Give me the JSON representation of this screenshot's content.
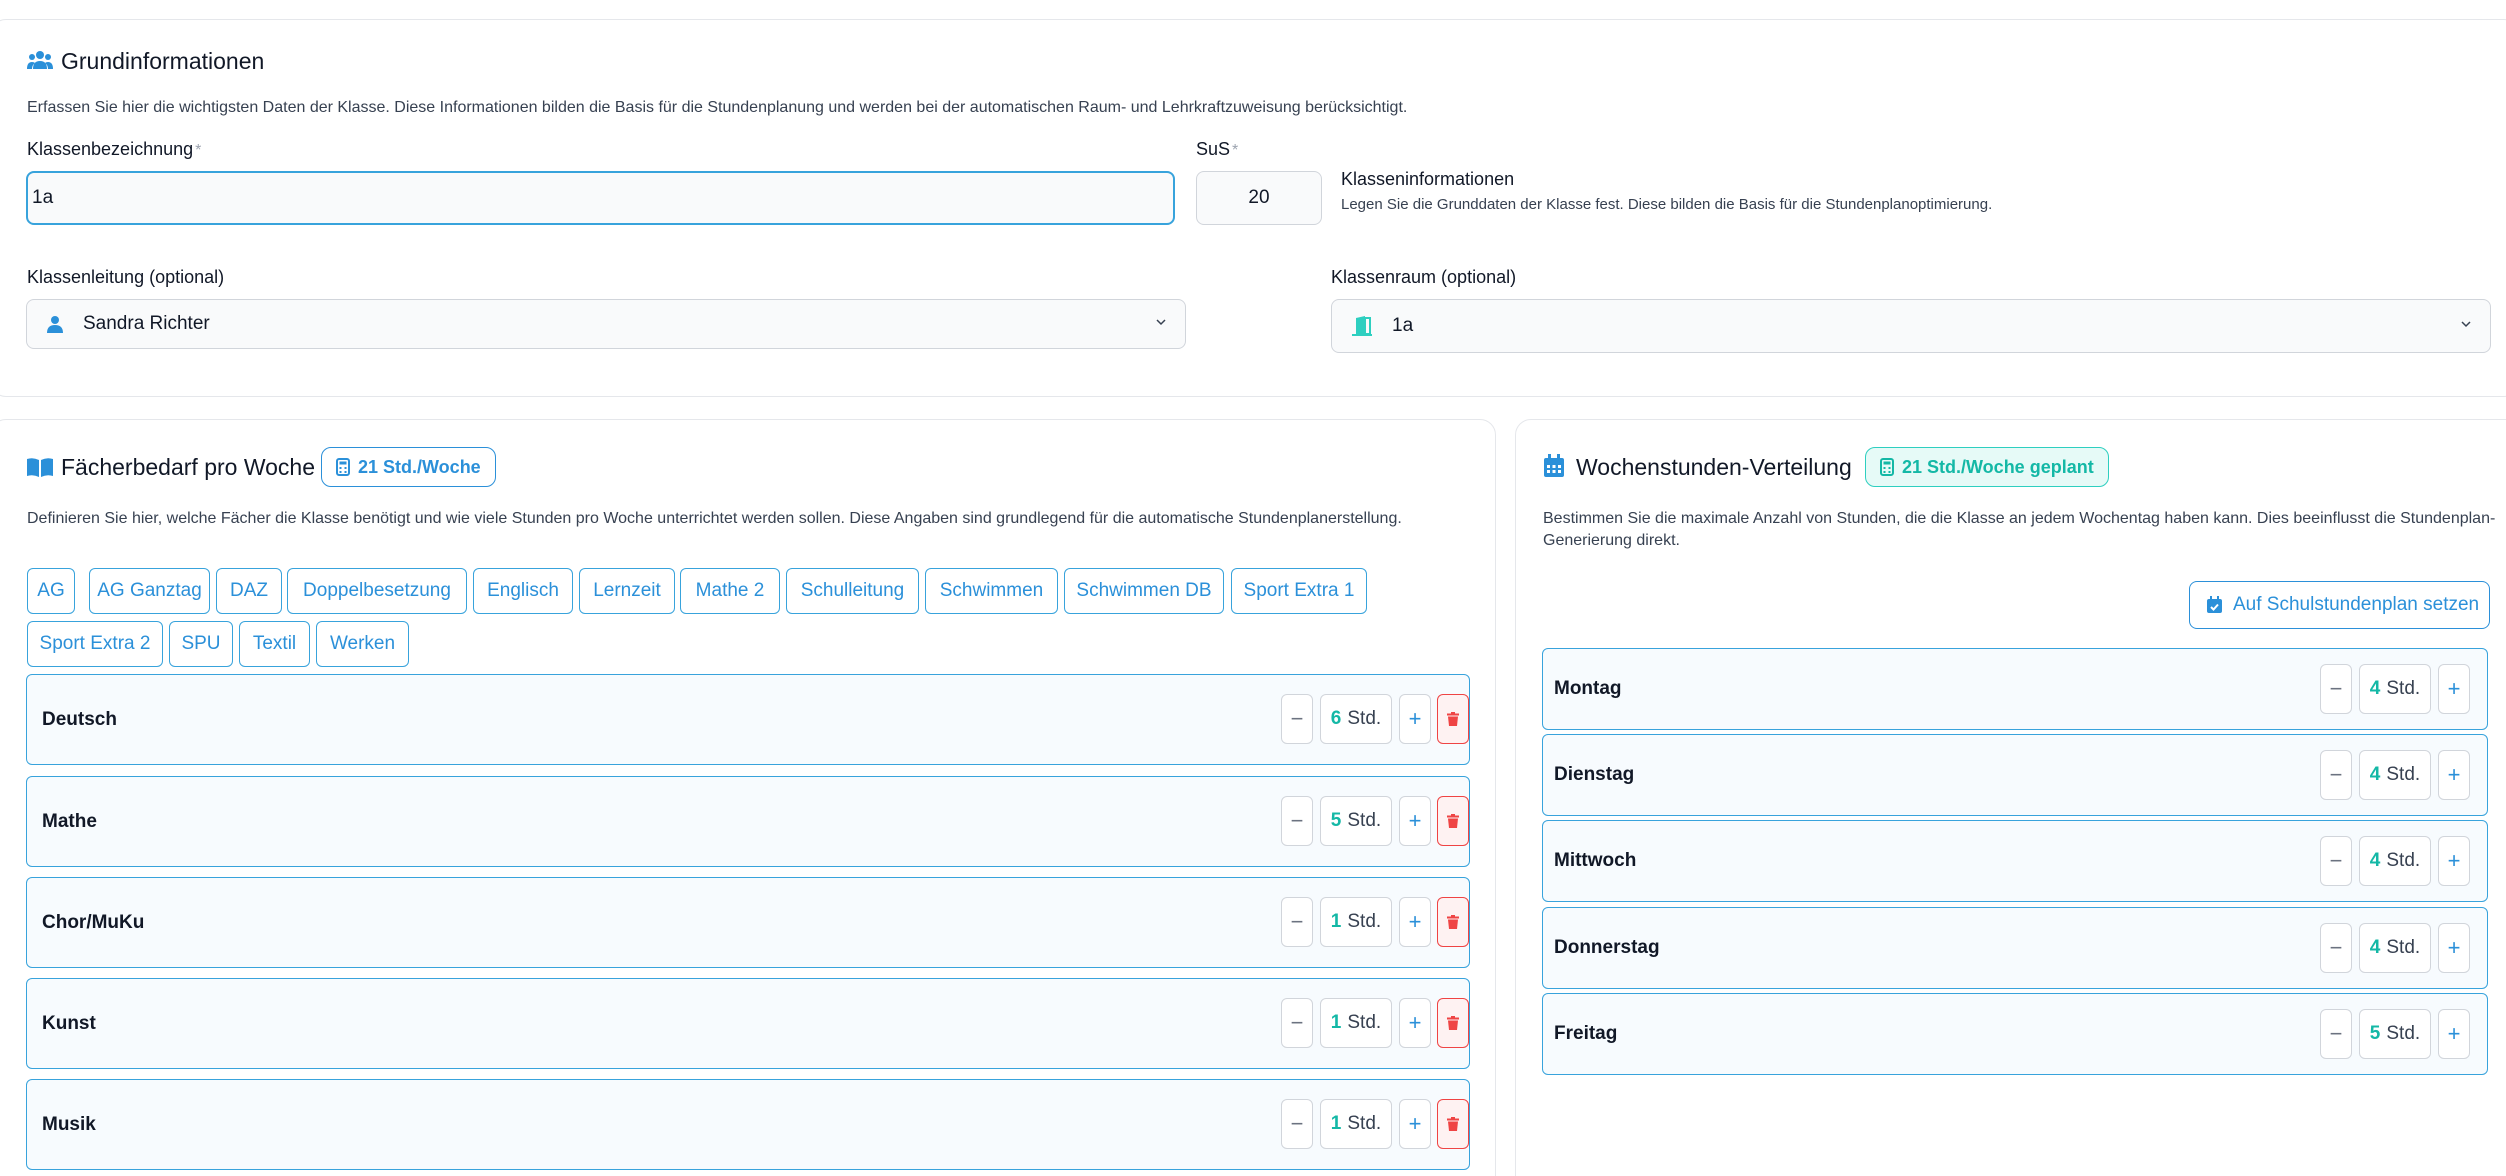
{
  "grund": {
    "title": "Grundinformationen",
    "description": "Erfassen Sie hier die wichtigsten Daten der Klasse. Diese Informationen bilden die Basis für die Stundenplanung und werden bei der automatischen Raum- und Lehrkraftzuweisung berücksichtigt.",
    "klassenbezeichnung_label": "Klassenbezeichnung",
    "klassenbezeichnung_value": "1a",
    "sus_label": "SuS",
    "sus_value": "20",
    "required_mark": "*",
    "info_title": "Klasseninformationen",
    "info_text": "Legen Sie die Grunddaten der Klasse fest. Diese bilden die Basis für die Stundenplanoptimierung.",
    "leitung_label": "Klassenleitung (optional)",
    "leitung_value": "Sandra Richter",
    "raum_label": "Klassenraum (optional)",
    "raum_value": "1a"
  },
  "faecher": {
    "title": "Fächerbedarf pro Woche",
    "badge": "21 Std./Woche",
    "description": "Definieren Sie hier, welche Fächer die Klasse benötigt und wie viele Stunden pro Woche unterrichtet werden sollen. Diese Angaben sind grundlegend für die automatische Stundenplanerstellung.",
    "chips": [
      "AG",
      "AG Ganztag",
      "DAZ",
      "Doppelbesetzung",
      "Englisch",
      "Lernzeit",
      "Mathe 2",
      "Schulleitung",
      "Schwimmen",
      "Schwimmen DB",
      "Sport Extra 1",
      "Sport Extra 2",
      "SPU",
      "Textil",
      "Werken"
    ],
    "unit": "Std.",
    "subjects": [
      {
        "name": "Deutsch",
        "hours": "6"
      },
      {
        "name": "Mathe",
        "hours": "5"
      },
      {
        "name": "Chor/MuKu",
        "hours": "1"
      },
      {
        "name": "Kunst",
        "hours": "1"
      },
      {
        "name": "Musik",
        "hours": "1"
      }
    ]
  },
  "woche": {
    "title": "Wochenstunden-Verteilung",
    "badge": "21 Std./Woche geplant",
    "description": "Bestimmen Sie die maximale Anzahl von Stunden, die die Klasse an jedem Wochentag haben kann. Dies beeinflusst die Stundenplan-Generierung direkt.",
    "button": "Auf Schulstundenplan setzen",
    "unit": "Std.",
    "days": [
      {
        "name": "Montag",
        "hours": "4"
      },
      {
        "name": "Dienstag",
        "hours": "4"
      },
      {
        "name": "Mittwoch",
        "hours": "4"
      },
      {
        "name": "Donnerstag",
        "hours": "4"
      },
      {
        "name": "Freitag",
        "hours": "5"
      }
    ]
  },
  "colors": {
    "accent": "#2b90d9",
    "teal": "#14b8a6",
    "danger": "#ef4444"
  }
}
